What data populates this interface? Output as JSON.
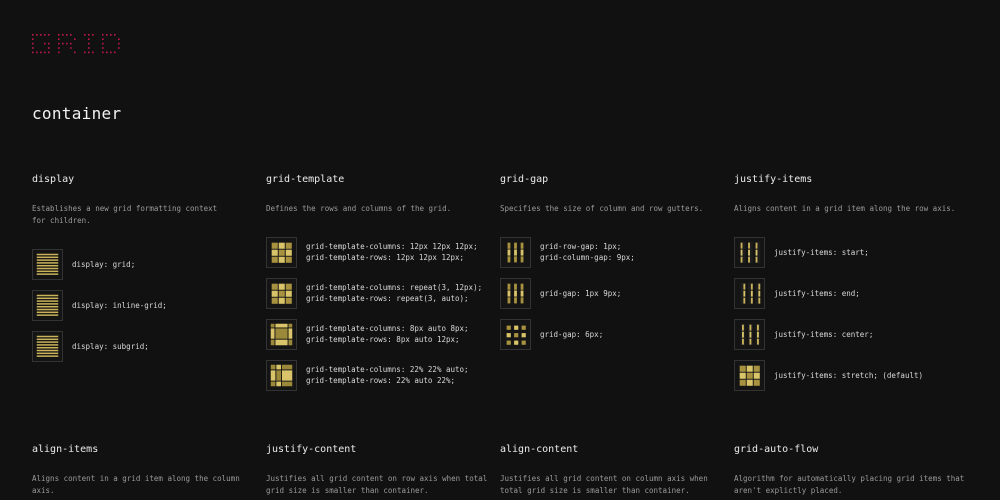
{
  "colors": {
    "background": "#111111",
    "accent_gold": "#c9b25a",
    "logo_red": "#c0184a"
  },
  "logo": {
    "text": "GRID"
  },
  "section_title": "container",
  "top_props": [
    {
      "title": "display",
      "description": "Establishes a new grid formatting context for children.",
      "examples": [
        {
          "icon": "lines-icon",
          "code": "display: grid;"
        },
        {
          "icon": "lines-icon",
          "code": "display: inline-grid;"
        },
        {
          "icon": "lines-icon",
          "code": "display: subgrid;"
        }
      ]
    },
    {
      "title": "grid-template",
      "description": "Defines the rows and columns of the grid.",
      "examples": [
        {
          "icon": "grid-3x3-icon",
          "code": "grid-template-columns: 12px 12px 12px;\ngrid-template-rows: 12px 12px 12px;"
        },
        {
          "icon": "grid-3x3-icon",
          "code": "grid-template-columns: repeat(3, 12px);\ngrid-template-rows: repeat(3, auto);"
        },
        {
          "icon": "grid-wide-icon",
          "code": "grid-template-columns: 8px auto 8px;\ngrid-template-rows: 8px auto 12px;"
        },
        {
          "icon": "grid-pct-icon",
          "code": "grid-template-columns: 22% 22% auto;\ngrid-template-rows: 22% auto 22%;"
        }
      ]
    },
    {
      "title": "grid-gap",
      "description": "Specifies the size of column and row gutters.",
      "examples": [
        {
          "icon": "gap-cols-icon",
          "code": "grid-row-gap: 1px;\ngrid-column-gap: 9px;"
        },
        {
          "icon": "gap-cols-icon",
          "code": "grid-gap: 1px 9px;"
        },
        {
          "icon": "gap-dots-icon",
          "code": "grid-gap: 6px;"
        }
      ]
    },
    {
      "title": "justify-items",
      "description": "Aligns content in a grid item along the row axis.",
      "examples": [
        {
          "icon": "justify-start-icon",
          "code": "justify-items: start;"
        },
        {
          "icon": "justify-end-icon",
          "code": "justify-items: end;"
        },
        {
          "icon": "justify-center-icon",
          "code": "justify-items: center;"
        },
        {
          "icon": "grid-3x3-icon",
          "code": "justify-items: stretch; (default)"
        }
      ]
    }
  ],
  "bottom_props": [
    {
      "title": "align-items",
      "description": "Aligns content in a grid item along the column\naxis."
    },
    {
      "title": "justify-content",
      "description": "Justifies all grid content on row axis when total\ngrid size is smaller than container."
    },
    {
      "title": "align-content",
      "description": "Justifies all grid content on column axis when\ntotal grid size is smaller than container."
    },
    {
      "title": "grid-auto-flow",
      "description": "Algorithm for automatically placing grid items that\naren't explictly placed."
    }
  ]
}
